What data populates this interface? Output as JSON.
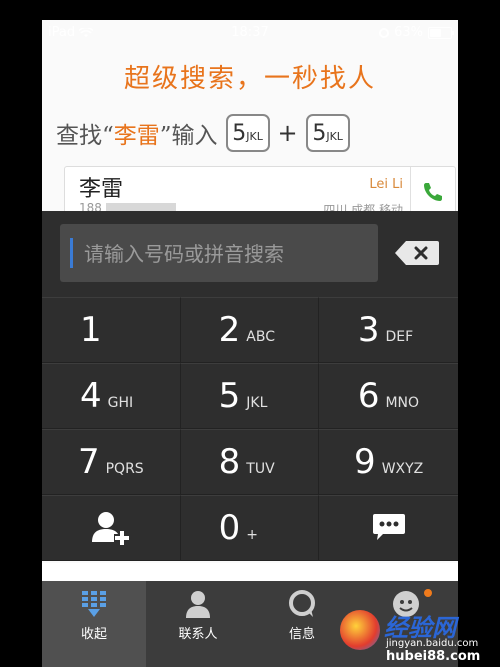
{
  "status_bar": {
    "device": "iPad",
    "time": "18:37",
    "battery": "63%",
    "battery_level": 0.63
  },
  "promo": {
    "headline": "超级搜索，一秒找人",
    "line_prefix": "查找“",
    "line_name": "李雷",
    "line_middle": "”输入",
    "key1_digit": "5",
    "key1_letters": "JKL",
    "plus": "+",
    "key2_digit": "5",
    "key2_letters": "JKL"
  },
  "contact": {
    "name": "李雷",
    "phone_visible": "188",
    "pinyin": "Lei Li",
    "location": "四川 成都 移动"
  },
  "search": {
    "placeholder": "请输入号码或拼音搜索"
  },
  "keypad": {
    "keys": [
      {
        "digit": "1",
        "letters": ""
      },
      {
        "digit": "2",
        "letters": "ABC"
      },
      {
        "digit": "3",
        "letters": "DEF"
      },
      {
        "digit": "4",
        "letters": "GHI"
      },
      {
        "digit": "5",
        "letters": "JKL"
      },
      {
        "digit": "6",
        "letters": "MNO"
      },
      {
        "digit": "7",
        "letters": "PQRS"
      },
      {
        "digit": "8",
        "letters": "TUV"
      },
      {
        "digit": "9",
        "letters": "WXYZ"
      },
      {
        "digit": "",
        "letters": ""
      },
      {
        "digit": "0",
        "letters": "+"
      },
      {
        "digit": "",
        "letters": ""
      }
    ]
  },
  "tabs": [
    {
      "label": "收起",
      "icon": "collapse-keypad-icon"
    },
    {
      "label": "联系人",
      "icon": "contacts-icon"
    },
    {
      "label": "信息",
      "icon": "messages-icon"
    },
    {
      "label": "",
      "icon": "avatar-icon"
    }
  ],
  "watermark": {
    "logo_text": "经验网",
    "url1": "jingyan.baidu.com",
    "url2": "hubei88.com"
  },
  "colors": {
    "accent_orange": "#e8741c",
    "dialer_bg": "#2e2e2e",
    "call_green": "#3aa83a",
    "cursor_blue": "#3a7bd5"
  }
}
